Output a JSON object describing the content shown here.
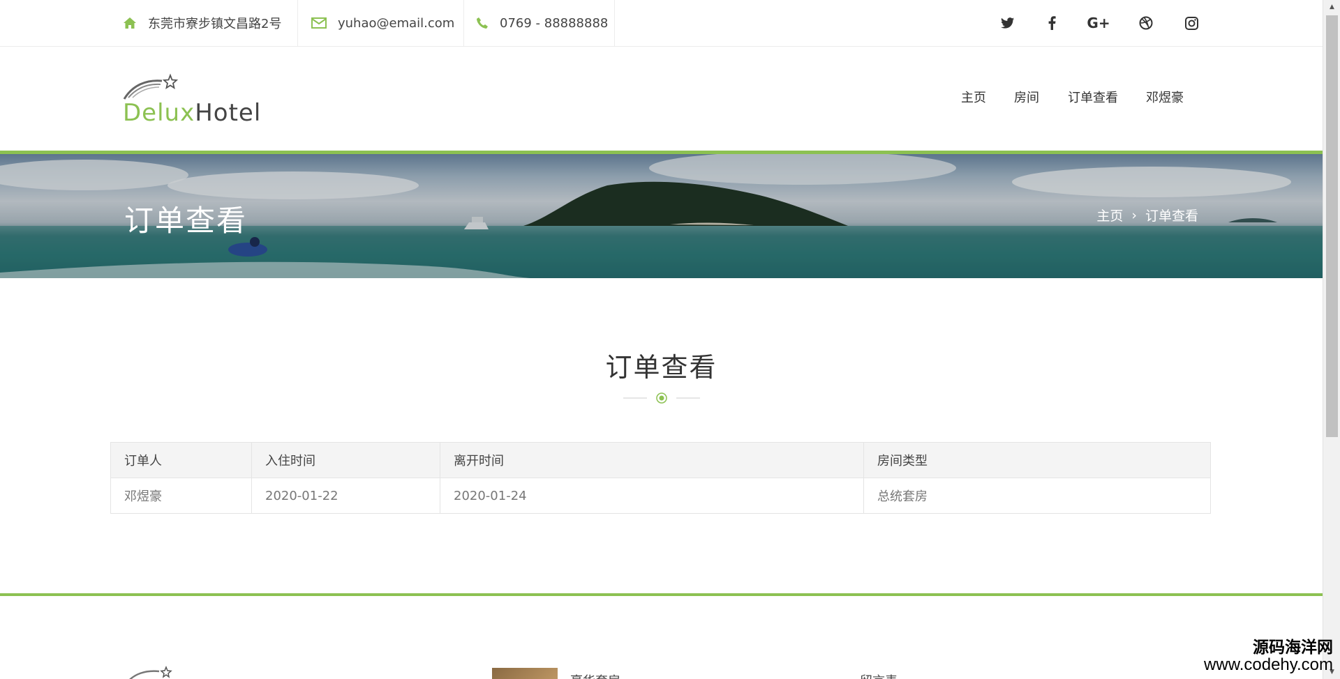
{
  "topbar": {
    "address": "东莞市寮步镇文昌路2号",
    "email": "yuhao@email.com",
    "phone": "0769 - 88888888",
    "social": [
      {
        "name": "twitter-icon",
        "glyph": "🐦"
      },
      {
        "name": "facebook-icon",
        "glyph": "f"
      },
      {
        "name": "google-plus-icon",
        "glyph": "G+"
      },
      {
        "name": "dribbble-icon",
        "glyph": "◎"
      },
      {
        "name": "instagram-icon",
        "glyph": "▢"
      }
    ]
  },
  "brand": {
    "part1": "Delux",
    "part2": "Hotel",
    "accent": "#8cc152"
  },
  "nav": {
    "home": "主页",
    "rooms": "房间",
    "orders": "订单查看",
    "user": "邓煜豪"
  },
  "banner": {
    "title": "订单查看",
    "breadcrumb": {
      "home": "主页",
      "sep": "›",
      "current": "订单查看"
    }
  },
  "section": {
    "title": "订单查看"
  },
  "table": {
    "headers": [
      "订单人",
      "入住时间",
      "离开时间",
      "房间类型"
    ],
    "rows": [
      [
        "邓煜豪",
        "2020-01-22",
        "2020-01-24",
        "总统套房"
      ]
    ]
  },
  "footer": {
    "col2_text": "豪华套房",
    "col3_text": "留言表"
  },
  "watermark": {
    "line1": "源码海洋网",
    "line2": "www.codehy.com"
  }
}
